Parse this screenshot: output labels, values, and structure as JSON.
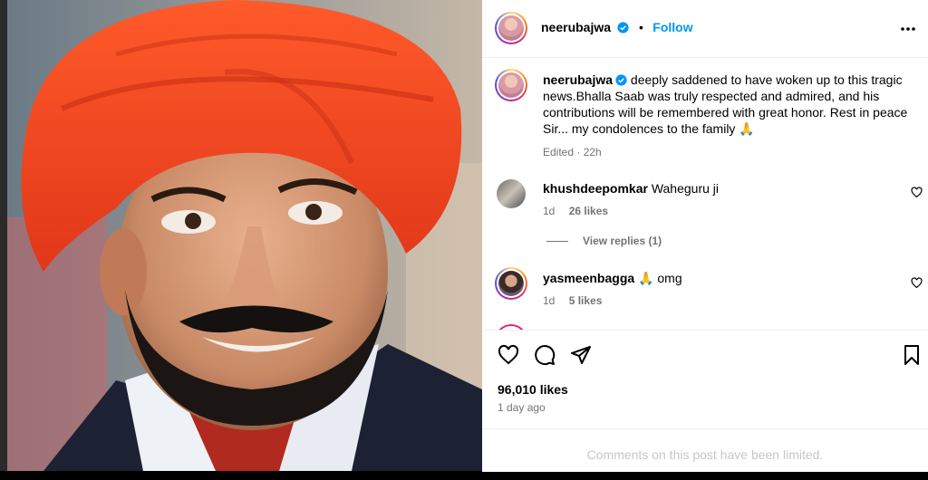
{
  "post": {
    "author": "neerubajwa",
    "follow_label": "Follow",
    "separator": "•",
    "caption": "deeply saddened to have woken up to this tragic news.Bhalla Saab was truly respected and admired, and his contributions will be remembered with great honor. Rest in peace Sir... my condolences to the family 🙏",
    "edited": "Edited · 22h"
  },
  "comments": [
    {
      "user": "khushdeepomkar",
      "text": "Waheguru ji",
      "age": "1d",
      "likes": "26 likes"
    },
    {
      "user": "yasmeenbagga",
      "text": "🙏 omg",
      "age": "1d",
      "likes": "5 likes"
    }
  ],
  "view_replies": "View replies (1)",
  "footer": {
    "likes": "96,010 likes",
    "time_ago": "1 day ago",
    "comments_limited": "Comments on this post have been limited."
  },
  "icons": {
    "verified": "verified-badge-icon",
    "more": "more-options-icon",
    "like": "heart-icon",
    "comment": "comment-icon",
    "share": "share-icon",
    "save": "bookmark-icon"
  },
  "colors": {
    "link": "#0095f6",
    "verified": "#0095f6",
    "secondary_text": "#737373",
    "turban": "#f2461e"
  }
}
